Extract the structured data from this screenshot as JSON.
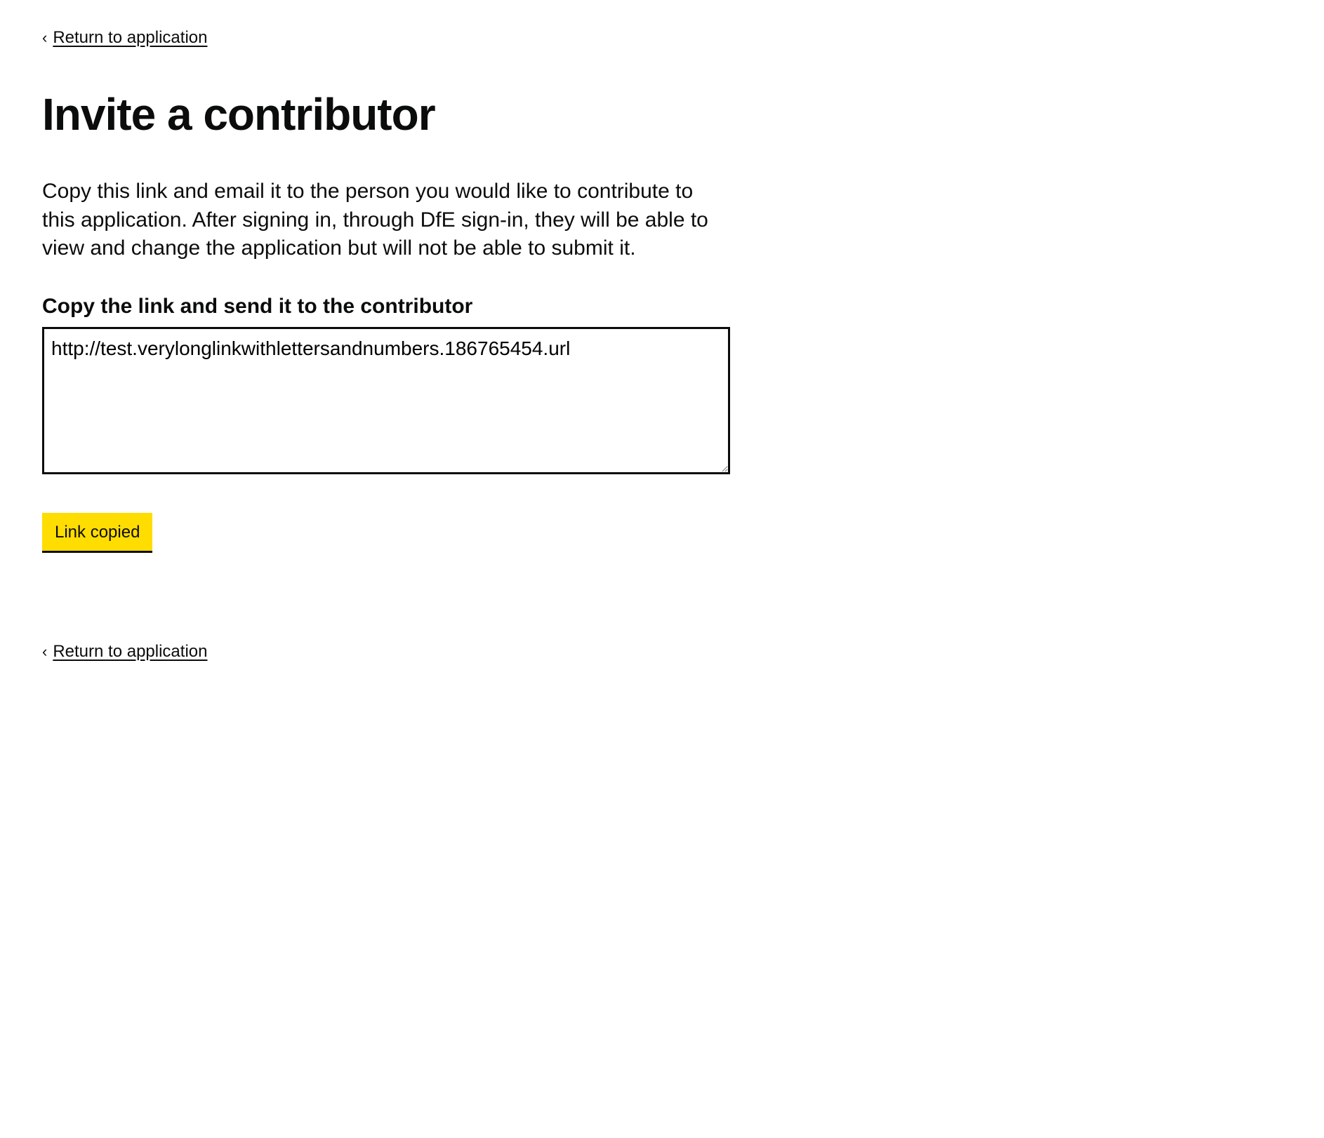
{
  "nav": {
    "return_label": "Return to application"
  },
  "page": {
    "title": "Invite a contributor",
    "description": "Copy this link and email it to the person you would like to contribute to this application. After signing in, through DfE sign-in, they will be able to view and change the application but will not be able to submit it."
  },
  "form": {
    "link_label": "Copy the link and send it to the contributor",
    "link_value": "http://test.verylonglinkwithlettersandnumbers.186765454.url",
    "copy_button_label": "Link copied"
  }
}
